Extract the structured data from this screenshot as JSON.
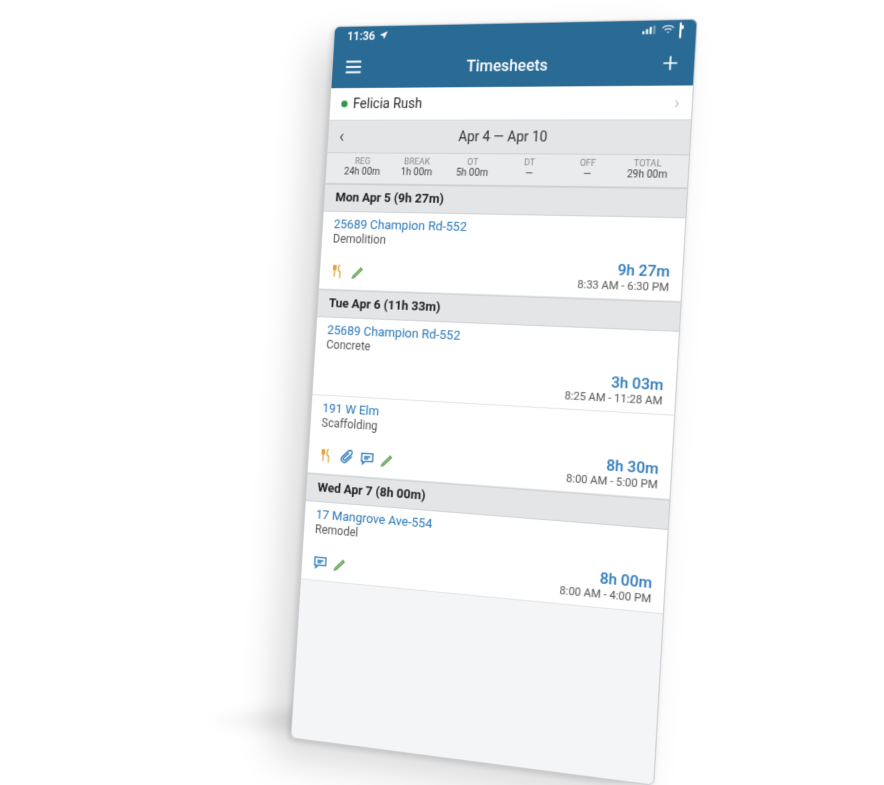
{
  "status_bar": {
    "time": "11:36"
  },
  "nav": {
    "title": "Timesheets"
  },
  "user": {
    "name": "Felicia Rush"
  },
  "date_range": "Apr 4 — Apr 10",
  "summary": {
    "cols": [
      {
        "label": "REG",
        "value": "24h 00m"
      },
      {
        "label": "BREAK",
        "value": "1h 00m"
      },
      {
        "label": "OT",
        "value": "5h 00m"
      },
      {
        "label": "DT",
        "value": "—"
      },
      {
        "label": "OFF",
        "value": "—"
      },
      {
        "label": "TOTAL",
        "value": "29h 00m"
      }
    ]
  },
  "days": [
    {
      "header": "Mon Apr 5 (9h 27m)",
      "entries": [
        {
          "project": "25689 Champion Rd-552",
          "task": "Demolition",
          "duration": "9h 27m",
          "range": "8:33 AM - 6:30 PM",
          "icons": [
            "meal",
            "edit"
          ]
        }
      ]
    },
    {
      "header": "Tue Apr 6 (11h 33m)",
      "entries": [
        {
          "project": "25689 Champion Rd-552",
          "task": "Concrete",
          "duration": "3h 03m",
          "range": "8:25 AM - 11:28 AM",
          "icons": []
        },
        {
          "project": "191 W Elm",
          "task": "Scaffolding",
          "duration": "8h 30m",
          "range": "8:00 AM - 5:00 PM",
          "icons": [
            "meal",
            "attachment",
            "comment",
            "edit"
          ]
        }
      ]
    },
    {
      "header": "Wed Apr 7 (8h 00m)",
      "entries": [
        {
          "project": "17 Mangrove Ave-554",
          "task": "Remodel",
          "duration": "8h 00m",
          "range": "8:00 AM - 4:00 PM",
          "icons": [
            "comment",
            "edit"
          ]
        }
      ]
    }
  ]
}
